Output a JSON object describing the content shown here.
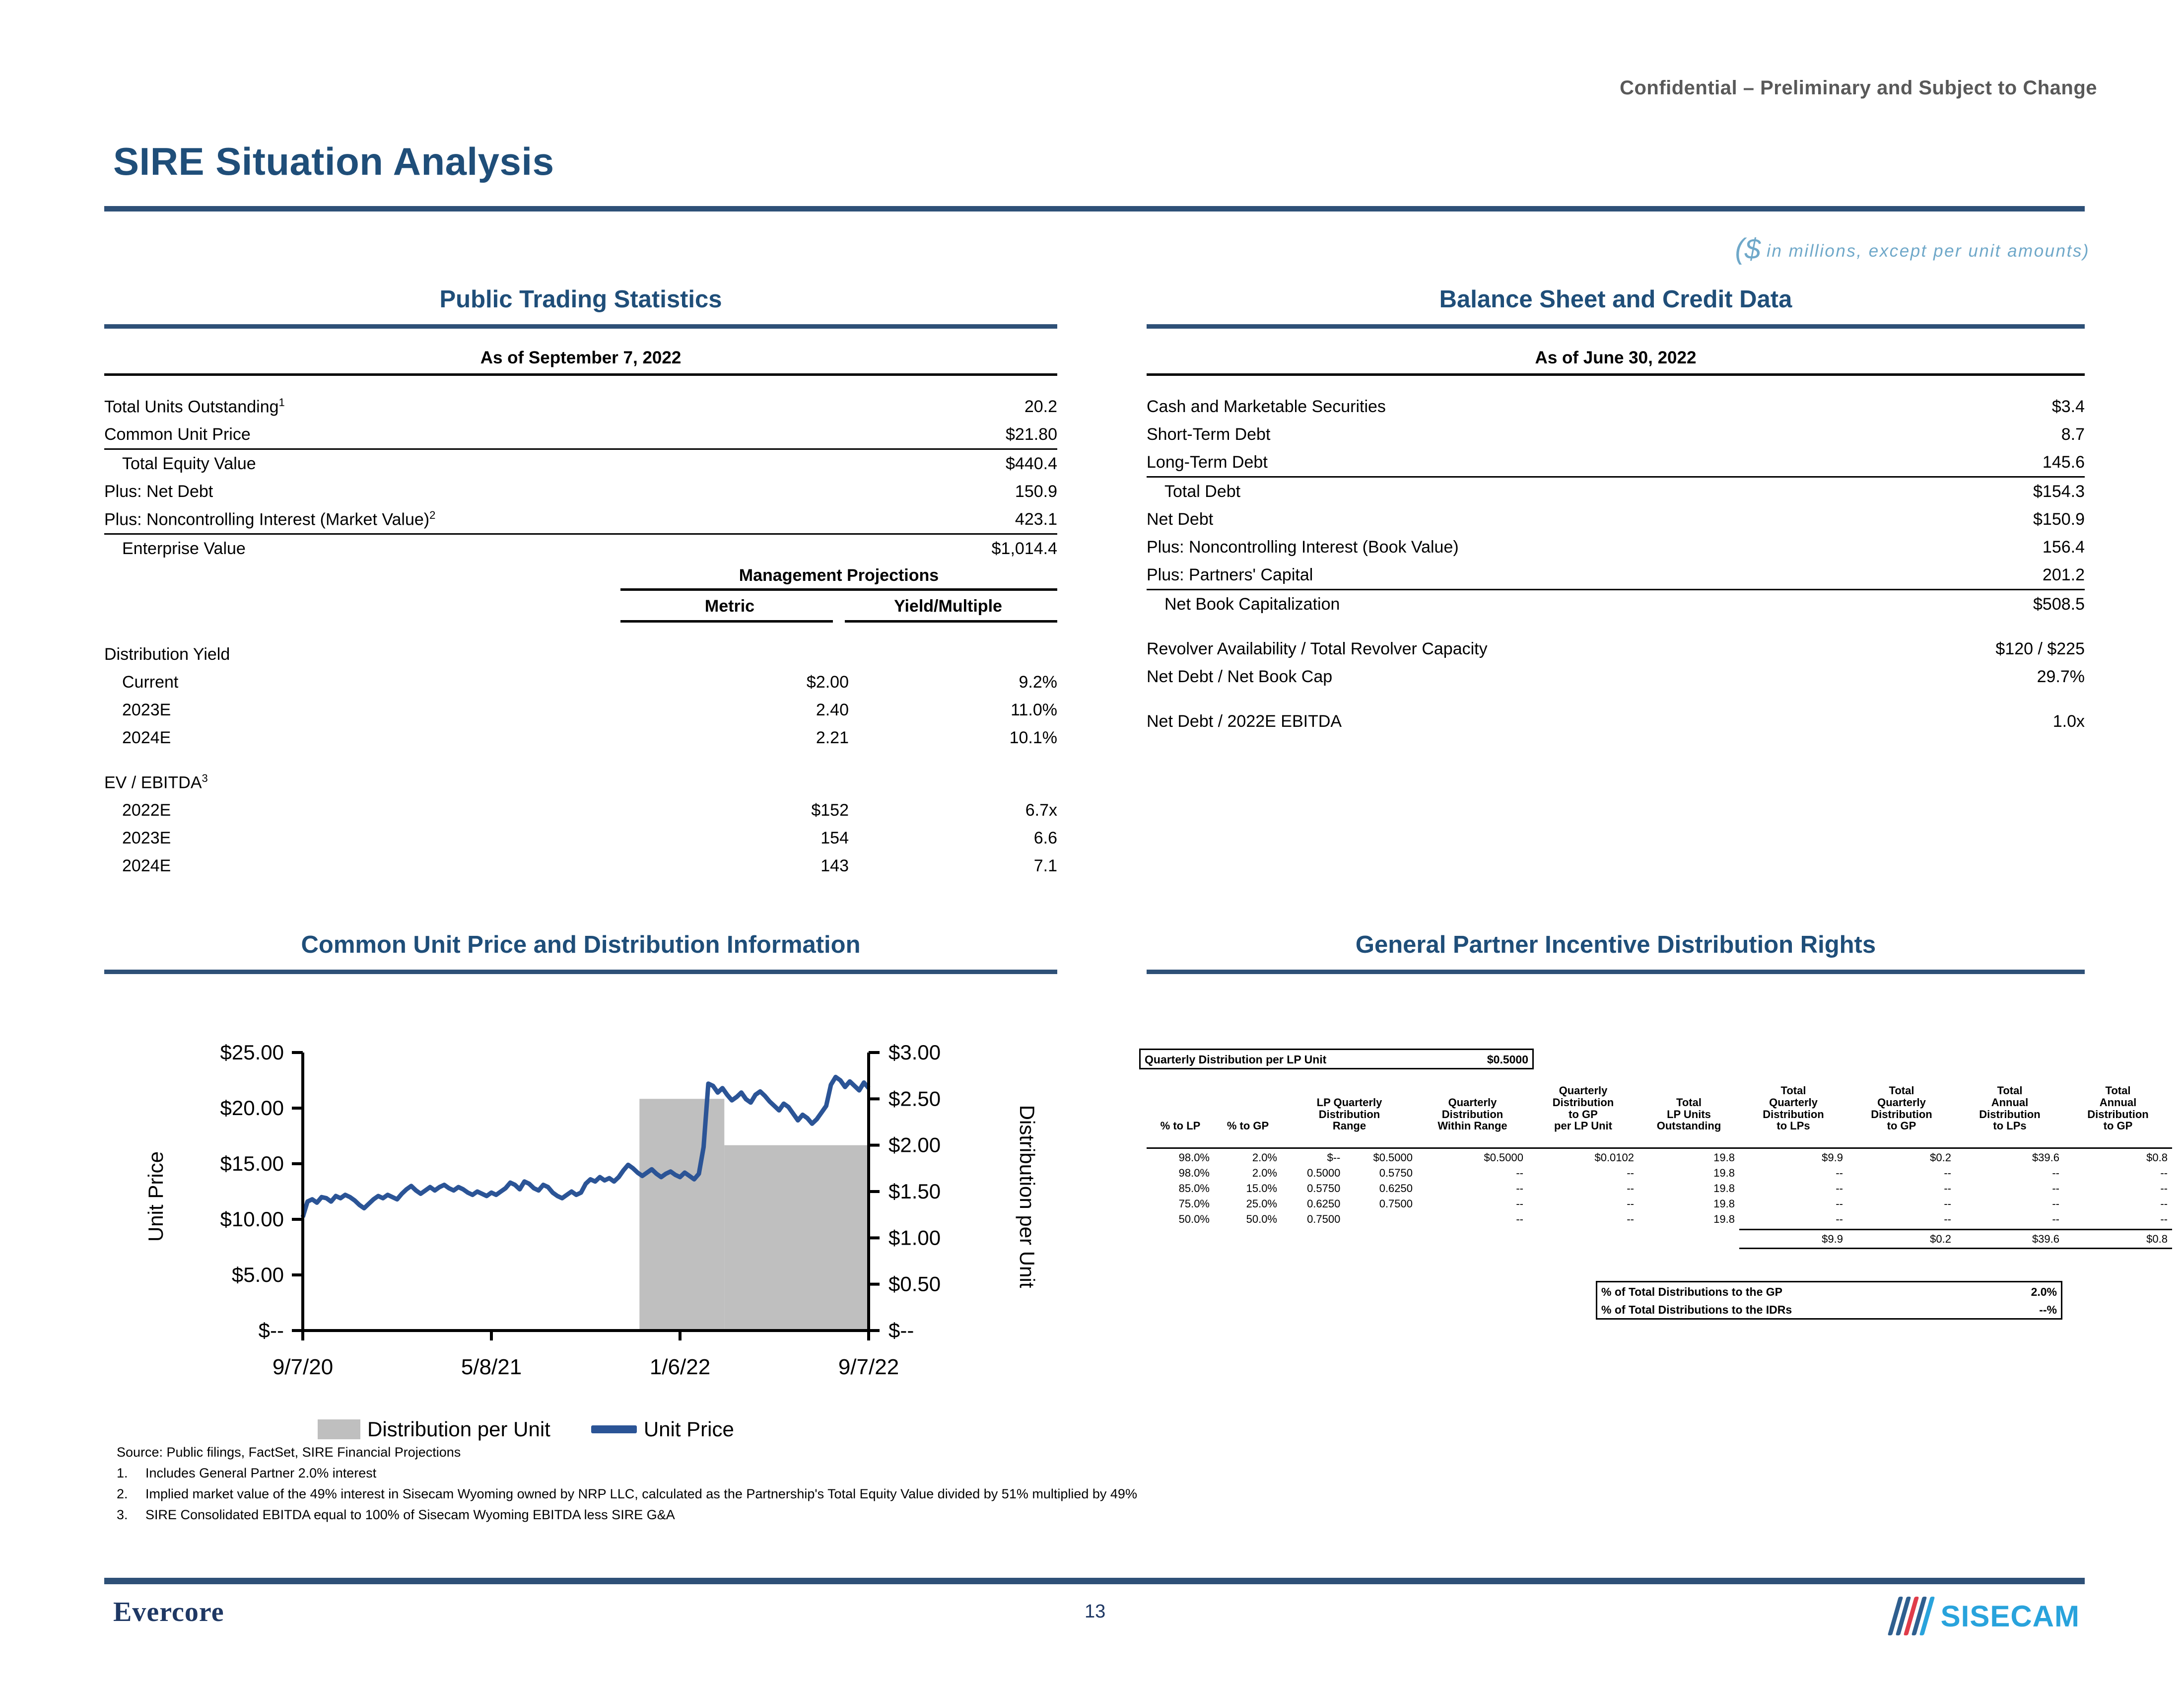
{
  "header": {
    "confidential": "Confidential – Preliminary and Subject to Change",
    "title": "SIRE Situation Analysis",
    "units_note_symbol": "($",
    "units_note": " in millions, except per unit amounts)"
  },
  "colors": {
    "brand_blue": "#1f4e79",
    "rule_blue": "#2e5077",
    "line_blue": "#2b5496",
    "bar_gray": "#bfbfbf",
    "accent_cyan": "#29a3dc",
    "accent_red": "#e03c4a"
  },
  "public_trading": {
    "heading": "Public Trading Statistics",
    "as_of": "As of September 7, 2022",
    "rows": [
      {
        "label": "Total Units Outstanding",
        "sup": "1",
        "value": "20.2",
        "indent": 0,
        "rule": ""
      },
      {
        "label": "Common Unit Price",
        "sup": "",
        "value": "$21.80",
        "indent": 0,
        "rule": "under"
      },
      {
        "label": "Total Equity Value",
        "sup": "",
        "value": "$440.4",
        "indent": 1,
        "rule": ""
      },
      {
        "label": "Plus: Net Debt",
        "sup": "",
        "value": "150.9",
        "indent": 0,
        "rule": ""
      },
      {
        "label": "Plus: Noncontrolling Interest (Market Value)",
        "sup": "2",
        "value": "423.1",
        "indent": 0,
        "rule": "under"
      },
      {
        "label": "Enterprise Value",
        "sup": "",
        "value": "$1,014.4",
        "indent": 1,
        "rule": ""
      }
    ],
    "projections": {
      "group_header": "Management Projections",
      "col_metric": "Metric",
      "col_yield": "Yield/Multiple",
      "sections": [
        {
          "title": "Distribution Yield",
          "sup": "",
          "rows": [
            {
              "label": "Current",
              "metric": "$2.00",
              "yield": "9.2%"
            },
            {
              "label": "2023E",
              "metric": "2.40",
              "yield": "11.0%"
            },
            {
              "label": "2024E",
              "metric": "2.21",
              "yield": "10.1%"
            }
          ]
        },
        {
          "title": "EV / EBITDA",
          "sup": "3",
          "rows": [
            {
              "label": "2022E",
              "metric": "$152",
              "yield": "6.7x"
            },
            {
              "label": "2023E",
              "metric": "154",
              "yield": "6.6"
            },
            {
              "label": "2024E",
              "metric": "143",
              "yield": "7.1"
            }
          ]
        }
      ]
    }
  },
  "balance_sheet": {
    "heading": "Balance Sheet and Credit Data",
    "as_of": "As of June 30, 2022",
    "rows": [
      {
        "label": "Cash and Marketable Securities",
        "value": "$3.4",
        "indent": 0,
        "rule": ""
      },
      {
        "label": "Short-Term Debt",
        "value": "8.7",
        "indent": 0,
        "rule": ""
      },
      {
        "label": "Long-Term Debt",
        "value": "145.6",
        "indent": 0,
        "rule": "under"
      },
      {
        "label": "Total Debt",
        "value": "$154.3",
        "indent": 1,
        "rule": ""
      },
      {
        "label": "Net Debt",
        "value": "$150.9",
        "indent": 0,
        "rule": ""
      },
      {
        "label": "Plus: Noncontrolling Interest (Book Value)",
        "value": "156.4",
        "indent": 0,
        "rule": ""
      },
      {
        "label": "Plus: Partners' Capital",
        "value": "201.2",
        "indent": 0,
        "rule": "under"
      },
      {
        "label": "Net Book Capitalization",
        "value": "$508.5",
        "indent": 1,
        "rule": ""
      }
    ],
    "credit_rows": [
      {
        "label": "Revolver Availability / Total Revolver Capacity",
        "value": "$120 / $225"
      },
      {
        "label": "Net Debt / Net Book Cap",
        "value": "29.7%"
      },
      {
        "label": "Net Debt / 2022E EBITDA",
        "value": "1.0x"
      }
    ]
  },
  "price_panel": {
    "heading": "Common Unit Price and Distribution Information",
    "legend": [
      {
        "key": "distribution-per-unit",
        "label": "Distribution per Unit",
        "type": "swatch"
      },
      {
        "key": "unit-price",
        "label": "Unit Price",
        "type": "line"
      }
    ]
  },
  "chart_data": {
    "type": "line",
    "title": "Common Unit Price and Distribution Information",
    "xlabel": "",
    "ylabel": "Unit Price",
    "y2label": "Distribution per Unit",
    "grid": false,
    "legend_position": "bottom",
    "x_ticks": [
      "9/7/20",
      "5/8/21",
      "1/6/22",
      "9/7/22"
    ],
    "y_ticks": [
      "$--",
      "$5.00",
      "$10.00",
      "$15.00",
      "$20.00",
      "$25.00"
    ],
    "ylim": [
      0,
      25
    ],
    "y2_ticks": [
      "$--",
      "$0.50",
      "$1.00",
      "$1.50",
      "$2.00",
      "$2.50",
      "$3.00"
    ],
    "y2lim": [
      0,
      3
    ],
    "series": [
      {
        "name": "Unit Price",
        "type": "line",
        "color": "#2b5496",
        "axis": "left",
        "values": [
          10.2,
          11.6,
          11.8,
          11.5,
          12.0,
          11.9,
          11.6,
          12.1,
          11.9,
          12.2,
          12.0,
          11.7,
          11.3,
          11.0,
          11.4,
          11.8,
          12.1,
          11.9,
          12.2,
          12.0,
          11.8,
          12.3,
          12.7,
          13.0,
          12.6,
          12.3,
          12.6,
          12.9,
          12.6,
          12.9,
          13.1,
          12.8,
          12.6,
          12.9,
          12.7,
          12.4,
          12.2,
          12.5,
          12.3,
          12.1,
          12.4,
          12.2,
          12.5,
          12.8,
          13.3,
          13.1,
          12.7,
          13.4,
          13.2,
          12.8,
          12.6,
          13.1,
          12.9,
          12.4,
          12.1,
          11.9,
          12.2,
          12.5,
          12.2,
          12.4,
          13.2,
          13.6,
          13.4,
          13.8,
          13.5,
          13.7,
          13.4,
          13.8,
          14.4,
          14.9,
          14.6,
          14.2,
          13.9,
          14.2,
          14.5,
          14.1,
          13.8,
          14.1,
          14.3,
          14.0,
          13.8,
          14.2,
          13.9,
          13.6,
          14.1,
          16.5,
          22.2,
          22.0,
          21.4,
          21.8,
          21.2,
          20.7,
          21.0,
          21.4,
          20.8,
          20.5,
          21.2,
          21.5,
          21.1,
          20.6,
          20.2,
          19.8,
          20.4,
          20.1,
          19.5,
          18.9,
          19.4,
          19.1,
          18.6,
          19.0,
          19.6,
          20.2,
          22.1,
          22.8,
          22.5,
          21.9,
          22.4,
          22.0,
          21.6,
          22.3,
          21.8
        ],
        "start_label": "9/7/20",
        "end_label": "9/7/22",
        "end_value": 21.8
      },
      {
        "name": "Distribution per Unit",
        "type": "bar",
        "color": "#bfbfbf",
        "axis": "right",
        "bars": [
          {
            "start_frac": 0.595,
            "end_frac": 0.745,
            "value": 2.5
          },
          {
            "start_frac": 0.745,
            "end_frac": 1.0,
            "value": 2.0
          }
        ]
      }
    ]
  },
  "idr_panel": {
    "heading": "General Partner Incentive Distribution Rights",
    "quarterly_box": {
      "label": "Quarterly Distribution per LP Unit",
      "value": "$0.5000"
    },
    "columns": [
      "% to LP",
      "% to GP",
      "LP Quarterly\nDistribution\nRange",
      "Quarterly\nDistribution\nWithin Range",
      "Quarterly\nDistribution\nto GP\nper LP Unit",
      "Total\nLP Units\nOutstanding",
      "Total\nQuarterly\nDistribution\nto LPs",
      "Total\nQuarterly\nDistribution\nto GP",
      "Total\nAnnual\nDistribution\nto LPs",
      "Total\nAnnual\nDistribution\nto GP"
    ],
    "rows": [
      {
        "pct_lp": "98.0%",
        "pct_gp": "2.0%",
        "range_lo": "$--",
        "range_hi": "$0.5000",
        "within": "$0.5000",
        "to_gp_per_unit": "$0.0102",
        "lp_units": "19.8",
        "q_lps": "$9.9",
        "q_gp": "$0.2",
        "a_lps": "$39.6",
        "a_gp": "$0.8"
      },
      {
        "pct_lp": "98.0%",
        "pct_gp": "2.0%",
        "range_lo": "0.5000",
        "range_hi": "0.5750",
        "within": "--",
        "to_gp_per_unit": "--",
        "lp_units": "19.8",
        "q_lps": "--",
        "q_gp": "--",
        "a_lps": "--",
        "a_gp": "--"
      },
      {
        "pct_lp": "85.0%",
        "pct_gp": "15.0%",
        "range_lo": "0.5750",
        "range_hi": "0.6250",
        "within": "--",
        "to_gp_per_unit": "--",
        "lp_units": "19.8",
        "q_lps": "--",
        "q_gp": "--",
        "a_lps": "--",
        "a_gp": "--"
      },
      {
        "pct_lp": "75.0%",
        "pct_gp": "25.0%",
        "range_lo": "0.6250",
        "range_hi": "0.7500",
        "within": "--",
        "to_gp_per_unit": "--",
        "lp_units": "19.8",
        "q_lps": "--",
        "q_gp": "--",
        "a_lps": "--",
        "a_gp": "--"
      },
      {
        "pct_lp": "50.0%",
        "pct_gp": "50.0%",
        "range_lo": "0.7500",
        "range_hi": "",
        "within": "--",
        "to_gp_per_unit": "--",
        "lp_units": "19.8",
        "q_lps": "--",
        "q_gp": "--",
        "a_lps": "--",
        "a_gp": "--"
      }
    ],
    "totals": {
      "q_lps": "$9.9",
      "q_gp": "$0.2",
      "a_lps": "$39.6",
      "a_gp": "$0.8"
    },
    "summary": [
      {
        "label": "% of Total Distributions to the GP",
        "value": "2.0%"
      },
      {
        "label": "% of Total Distributions to the IDRs",
        "value": "--%"
      }
    ]
  },
  "notes": {
    "source": "Source: Public filings, FactSet, SIRE Financial Projections",
    "items": [
      {
        "n": "1.",
        "text": "Includes General Partner 2.0% interest"
      },
      {
        "n": "2.",
        "text": "Implied market value of the 49% interest in Sisecam Wyoming owned by NRP LLC, calculated as the Partnership's Total Equity Value divided by 51% multiplied by 49%"
      },
      {
        "n": "3.",
        "text": "SIRE Consolidated EBITDA equal to 100% of Sisecam Wyoming EBITDA less SIRE G&A"
      }
    ]
  },
  "footer": {
    "firm": "Evercore",
    "page": "13",
    "client": "SISECAM"
  }
}
